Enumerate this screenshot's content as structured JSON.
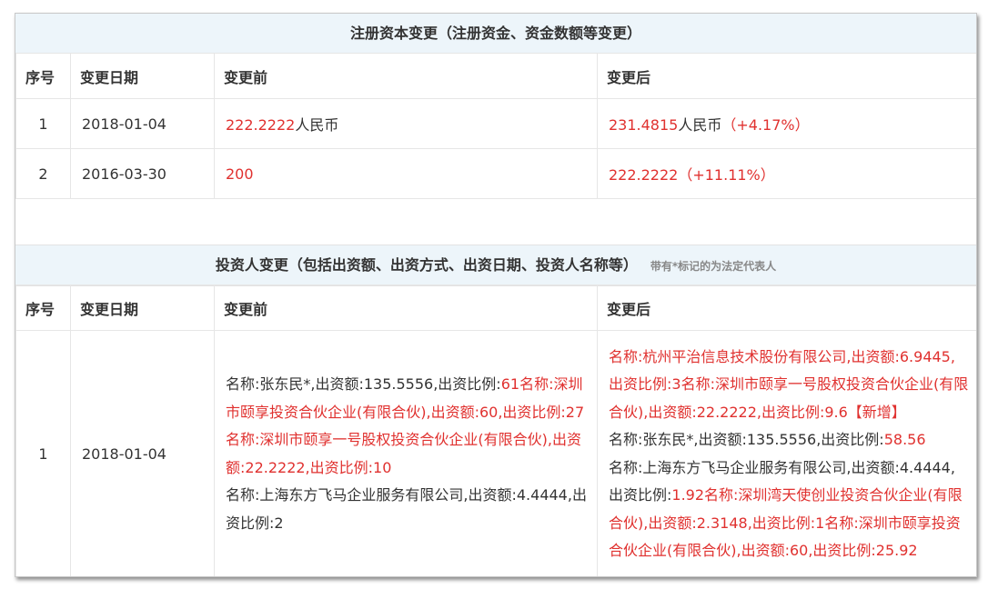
{
  "section1": {
    "title": "注册资本变更（注册资金、资金数额等变更）",
    "headers": [
      "序号",
      "变更日期",
      "变更前",
      "变更后"
    ],
    "rows": [
      {
        "index": "1",
        "date": "2018-01-04",
        "before_value": "222.2222",
        "before_unit": "人民币",
        "after_value": "231.4815",
        "after_unit": "人民币",
        "after_change": "（+4.17%）"
      },
      {
        "index": "2",
        "date": "2016-03-30",
        "before_value": "200",
        "before_unit": "",
        "after_value": "222.2222",
        "after_unit": "",
        "after_change": "（+11.11%）"
      }
    ]
  },
  "section2": {
    "title": "投资人变更（包括出资额、出资方式、出资日期、投资人名称等）",
    "note": "带有*标记的为法定代表人",
    "headers": [
      "序号",
      "变更日期",
      "变更前",
      "变更后"
    ],
    "rows": [
      {
        "index": "1",
        "date": "2018-01-04",
        "before": [
          {
            "text": "名称:张东民*,出资额:135.5556,出资比例:",
            "red": false
          },
          {
            "text": "61名称:深圳市颐享投资合伙企业(有限合伙),出资额:60,出资比例:27名称:深圳市颐享一号股权投资合伙企业(有限合伙),出资额:22.2222,出资比例:10",
            "red": true
          },
          {
            "text": "名称:上海东方飞马企业服务有限公司,出资额:4.4444,出资比例:2",
            "red": false
          }
        ],
        "after": [
          {
            "text": "名称:杭州平治信息技术股份有限公司,出资额:6.9445,出资比例:3名称:深圳市颐享一号股权投资合伙企业(有限合伙),出资额:22.2222,出资比例:9.6【新增】",
            "red": true
          },
          {
            "text": "名称:张东民*,出资额:135.5556,出资比例:",
            "red": false
          },
          {
            "text": "58.56",
            "red": true
          },
          {
            "text": "名称:上海东方飞马企业服务有限公司,出资额:4.4444,出资比例:",
            "red": false
          },
          {
            "text": "1.92名称:深圳湾天使创业投资合伙企业(有限合伙),出资额:2.3148,出资比例:1名称:深圳市颐享投资合伙企业(有限合伙),出资额:60,出资比例:25.92",
            "red": true
          }
        ]
      }
    ]
  },
  "colors": {
    "header_bg": "#edf5fa",
    "highlight_red": "#e0312f",
    "text": "#333333",
    "note_gray": "#888888"
  }
}
